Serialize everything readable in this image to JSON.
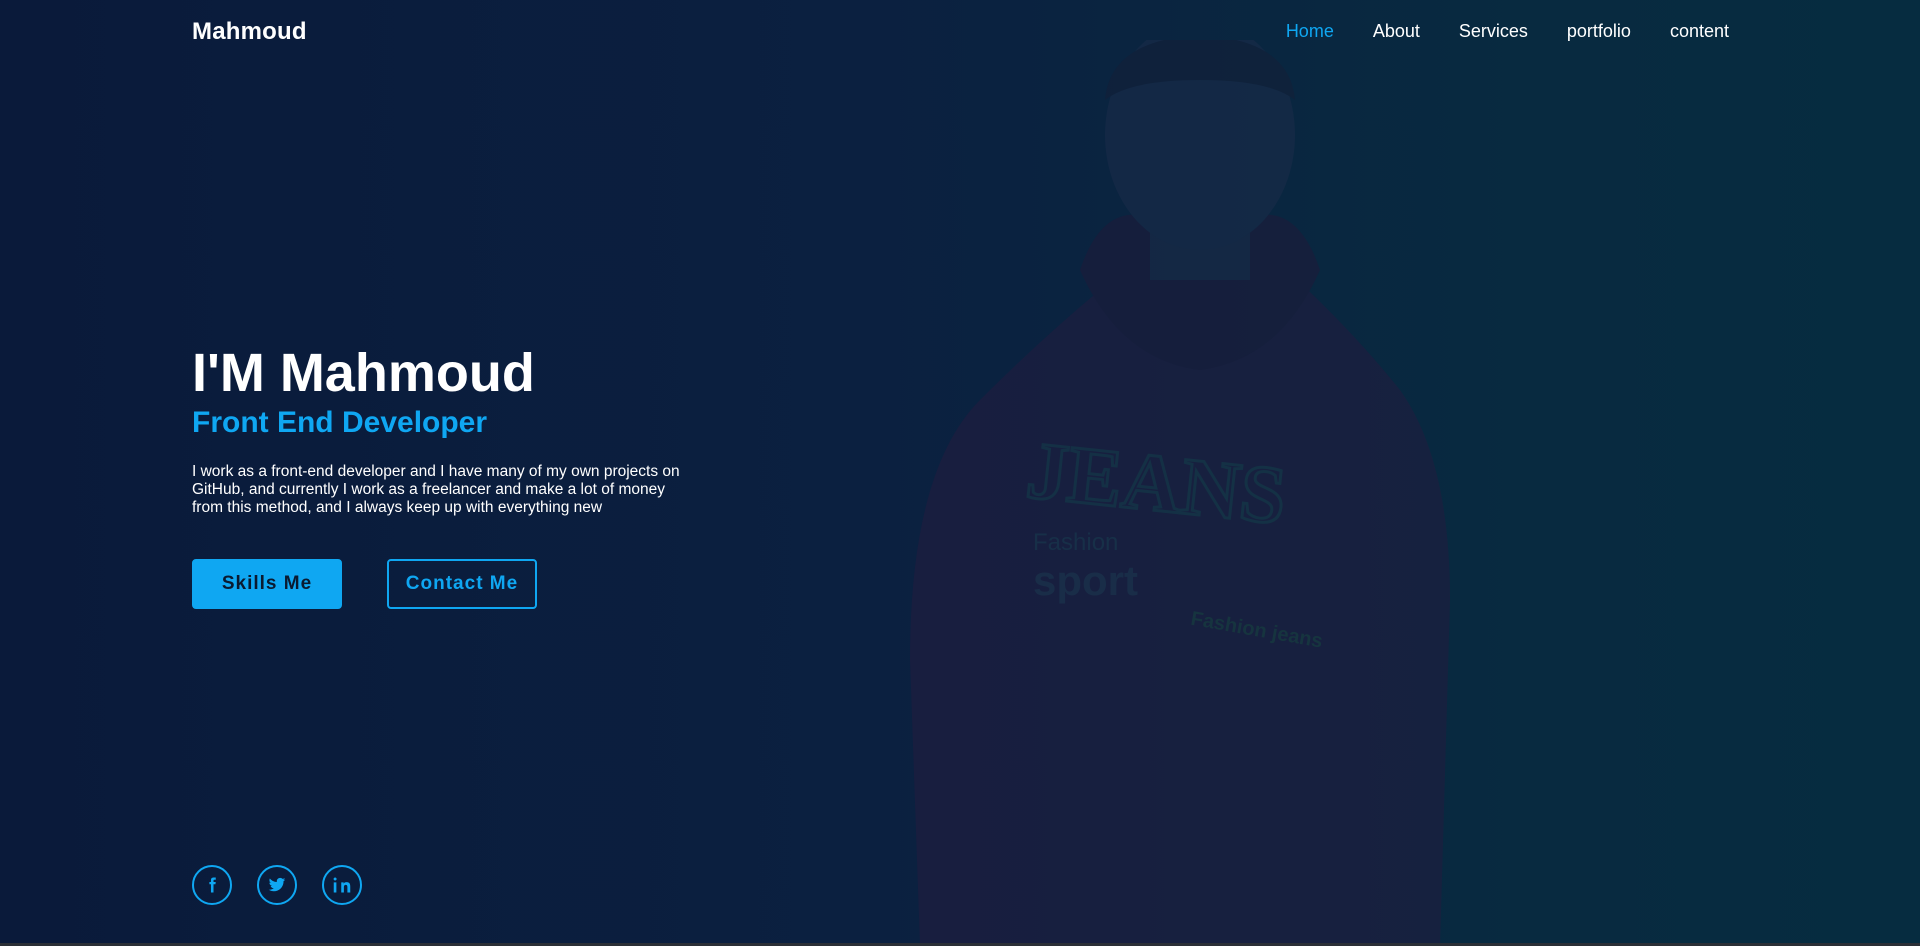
{
  "header": {
    "logo": "Mahmoud",
    "nav": [
      {
        "label": "Home",
        "active": true
      },
      {
        "label": "About",
        "active": false
      },
      {
        "label": "Services",
        "active": false
      },
      {
        "label": "portfolio",
        "active": false
      },
      {
        "label": "content",
        "active": false
      }
    ]
  },
  "hero": {
    "title": "I'M Mahmoud",
    "subtitle": "Front End Developer",
    "description": "I work as a front-end developer and I have many of my own projects on GitHub, and currently I work as a freelancer and make a lot of money from this method, and I always keep up with everything new",
    "primary_button": "Skills Me",
    "secondary_button": "Contact Me"
  },
  "background": {
    "shirt_text_main": "JEANS",
    "shirt_text_fashion": "Fashion",
    "shirt_text_sport": "sport",
    "shirt_text_jeans": "Fashion jeans"
  },
  "socials": [
    {
      "icon": "facebook-icon"
    },
    {
      "icon": "twitter-icon"
    },
    {
      "icon": "linkedin-icon"
    }
  ],
  "colors": {
    "accent": "#0fa7f2",
    "background": "#0b1b36",
    "text": "#ffffff"
  }
}
